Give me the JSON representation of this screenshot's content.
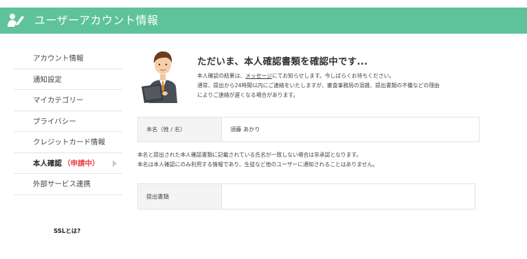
{
  "header": {
    "title": "ユーザーアカウント情報",
    "icon": "user-edit-icon",
    "color": "#5ec39a"
  },
  "sidebar": {
    "items": [
      {
        "label": "アカウント情報"
      },
      {
        "label": "通知設定"
      },
      {
        "label": "マイカテゴリー"
      },
      {
        "label": "プライバシー"
      },
      {
        "label": "クレジットカード情報"
      },
      {
        "label": "本人確認",
        "status": "（申請中）",
        "active": true
      },
      {
        "label": "外部サービス連携"
      }
    ],
    "ssl_link": "SSLとは?"
  },
  "main": {
    "heading": "ただいま、本人確認書類を確認中です...",
    "desc_line1_pre": "本人確認の結果は、",
    "desc_line1_link": "メッセージ",
    "desc_line1_post": "にてお知らせします。今しばらくお待ちください。",
    "desc_line2": "通常、提出から24時間以内にご連絡をいたしますが、審査事務局の混雑、提出書類の不備などの理由",
    "desc_line3": "によりご連絡が遅くなる場合があります。",
    "name_label": "本名（姓 / 名）",
    "name_value": "須藤 あかり",
    "note_line1": "本名と提出された本人確認書類に記載されている氏名が一致しない場合は非承認となります。",
    "note_line2": "本名は本人確認にのみ利用する情報であり、生徒など他のユーザーに通知されることはありません。",
    "doc_label": "提出書類",
    "doc_value": ""
  }
}
